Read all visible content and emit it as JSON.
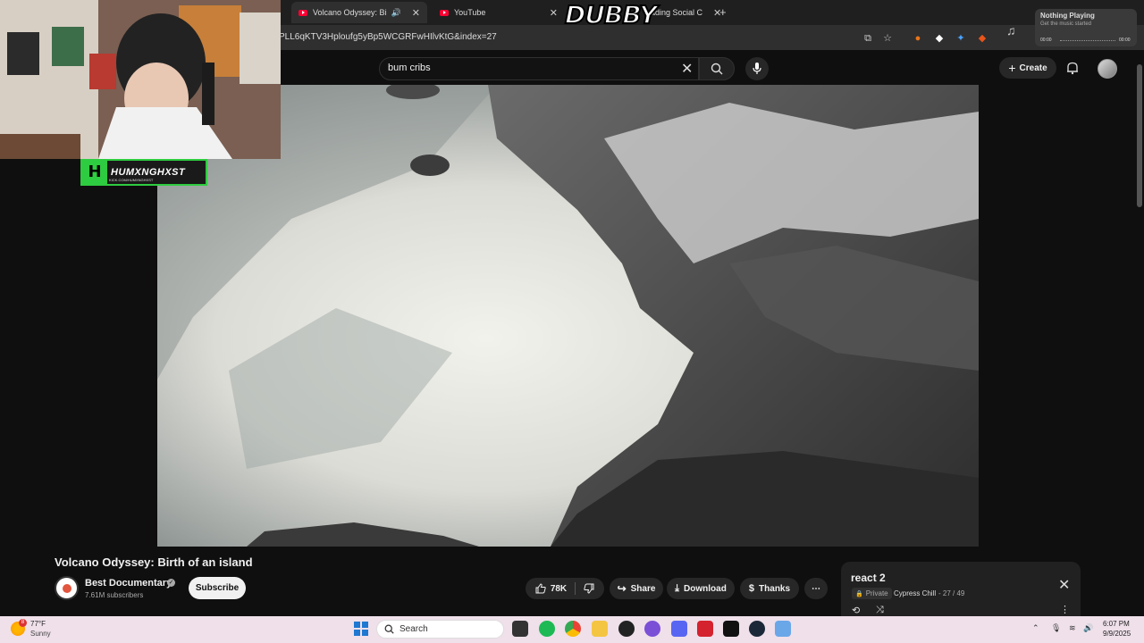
{
  "browser": {
    "tabs": [
      {
        "label": "Volcano Odyssey: Birth of an",
        "active": true
      },
      {
        "label": "YouTube",
        "active": false
      },
      {
        "label": "ading Social C",
        "active": false
      }
    ],
    "new_tab": "+",
    "url": "PLL6qKTV3Hploufg5yBp5WCGRFwHIlvKtG&index=27"
  },
  "overlay": {
    "streamer_logo": "H",
    "streamer_name": "HUMXNGHXST",
    "streamer_sub": "KICK.COM/HUMXNGHXST",
    "dubby": "DUBBY"
  },
  "music_widget": {
    "title": "Nothing Playing",
    "subtitle": "Get the music started",
    "time_start": "00:00",
    "time_end": "00:00"
  },
  "youtube": {
    "search": {
      "query": "bum cribs"
    },
    "create_label": "Create",
    "video": {
      "title": "Volcano Odyssey: Birth of an island",
      "channel": "Best Documentary",
      "subscribers": "7.61M subscribers",
      "subscribe_label": "Subscribe",
      "likes": "78K",
      "share_label": "Share",
      "download_label": "Download",
      "thanks_label": "Thanks",
      "more_label": "⋯"
    },
    "playlist": {
      "title": "react 2",
      "privacy": "Private",
      "owner": "Cypress Chill",
      "position": "- 27 / 49"
    }
  },
  "taskbar": {
    "weather_temp": "77°F",
    "weather_cond": "Sunny",
    "weather_badge": "8",
    "search_label": "Search",
    "time": "6:07 PM",
    "date": "9/9/2025"
  },
  "colors": {
    "yt_red": "#ff0033",
    "streamer_green": "#2ecc40",
    "taskbar_bg": "#efe0ea"
  }
}
